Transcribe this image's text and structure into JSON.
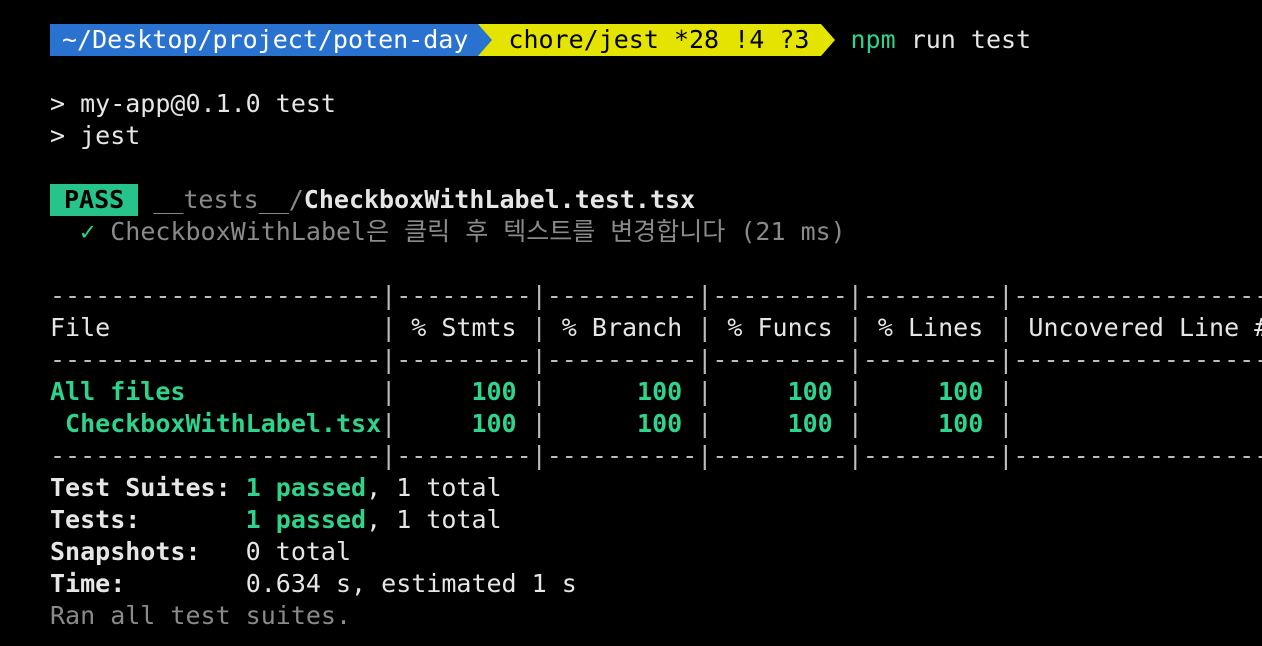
{
  "prompt": {
    "path": "~/Desktop/project/poten-day",
    "git": "chore/jest *28 !4 ?3",
    "command_name": "npm",
    "command_args": "run test",
    "path_bg": "#2a72cf",
    "git_bg": "#e4e400"
  },
  "npm_output": {
    "line1": "> my-app@0.1.0 test",
    "line2": "> jest"
  },
  "result": {
    "badge": "PASS",
    "dir": "__tests__/",
    "file": "CheckboxWithLabel.test.tsx",
    "test_check": "✓",
    "test_name": "CheckboxWithLabel은 클릭 후 텍스트를 변경합니다",
    "test_time": "(21 ms)"
  },
  "coverage": {
    "separator_cols": [
      "----------------------",
      "---------",
      "----------",
      "---------",
      "---------",
      "-------------------"
    ],
    "headers": [
      "File",
      "% Stmts",
      "% Branch",
      "% Funcs",
      "% Lines",
      "Uncovered Line #s"
    ],
    "rows": [
      {
        "file": "All files",
        "stmts": "100",
        "branch": "100",
        "funcs": "100",
        "lines": "100",
        "uncovered": ""
      },
      {
        "file": " CheckboxWithLabel.tsx",
        "stmts": "100",
        "branch": "100",
        "funcs": "100",
        "lines": "100",
        "uncovered": ""
      }
    ]
  },
  "summary": {
    "suites_label": "Test Suites:",
    "suites_passed": "1 passed",
    "suites_total": ", 1 total",
    "tests_label": "Tests:",
    "tests_passed": "1 passed",
    "tests_total": ", 1 total",
    "snapshots_label": "Snapshots:",
    "snapshots_value": "0 total",
    "time_label": "Time:",
    "time_value": "0.634 s, estimated 1 s",
    "footer": "Ran all test suites."
  },
  "colors": {
    "success": "#2ed38c",
    "pass_badge": "#26c48a",
    "muted": "#8a8a8a",
    "background": "#000000"
  }
}
